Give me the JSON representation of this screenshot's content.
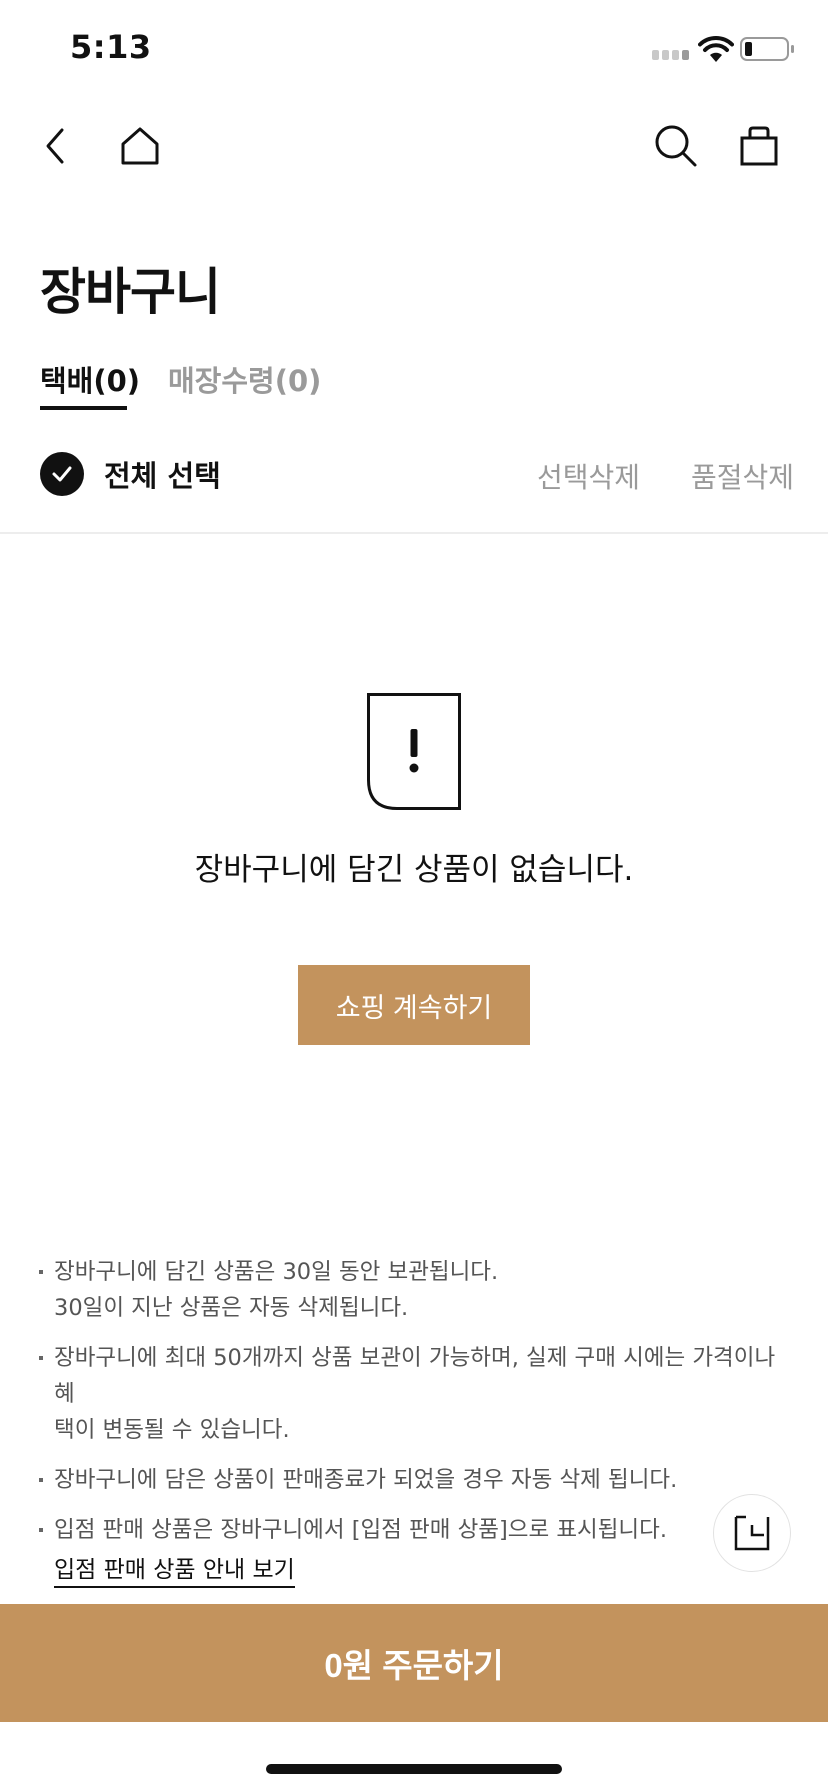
{
  "status_bar": {
    "time": "5:13",
    "icons": [
      "cellular-signal-icon",
      "wifi-icon",
      "battery-icon"
    ]
  },
  "nav": {
    "icons": [
      "back-icon",
      "home-icon",
      "search-icon",
      "shopping-bag-icon"
    ]
  },
  "page_title": "장바구니",
  "tabs": [
    {
      "label": "택배(0)",
      "active": true
    },
    {
      "label": "매장수령(0)",
      "active": false
    }
  ],
  "selection": {
    "select_all_label": "전체 선택",
    "delete_selected_label": "선택삭제",
    "delete_soldout_label": "품절삭제"
  },
  "empty_state": {
    "icon": "alert-document-icon",
    "message": "장바구니에 담긴 상품이 없습니다.",
    "continue_label": "쇼핑 계속하기"
  },
  "notes": [
    {
      "line1": "장바구니에 담긴 상품은 30일 동안 보관됩니다.",
      "line2": "30일이 지난 상품은 자동 삭제됩니다."
    },
    {
      "line1": "장바구니에 최대 50개까지 상품 보관이 가능하며, 실제 구매 시에는 가격이나 혜",
      "line2": "택이 변동될 수 있습니다."
    },
    {
      "line1": "장바구니에 담은 상품이 판매종료가 되었을 경우 자동 삭제 됩니다.",
      "line2": ""
    },
    {
      "line1": "입점 판매 상품은 장바구니에서 [입점 판매 상품]으로 표시됩니다.",
      "line2": ""
    }
  ],
  "guide_link": "입점 판매 상품 안내 보기",
  "order_button": "0원 주문하기",
  "colors": {
    "accent": "#c3935d",
    "text_primary": "#111111",
    "text_muted": "#9a9a9a"
  }
}
